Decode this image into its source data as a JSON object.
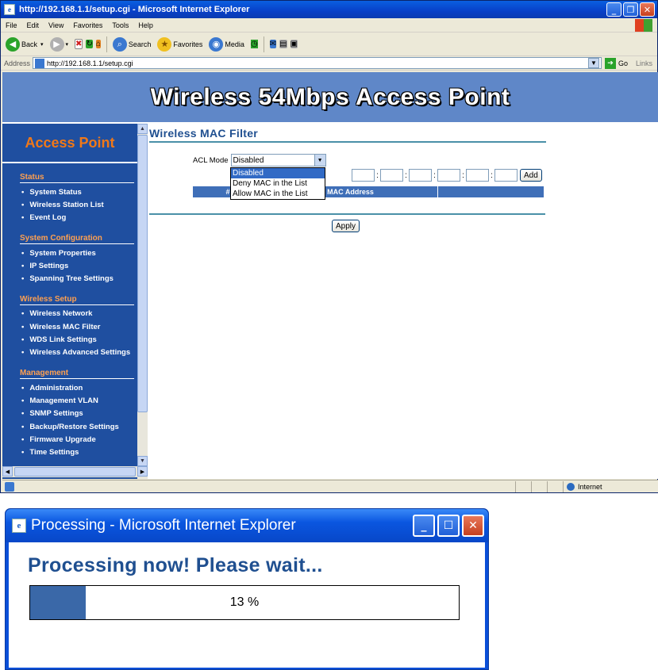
{
  "browser": {
    "title": "http://192.168.1.1/setup.cgi - Microsoft Internet Explorer",
    "menu": [
      "File",
      "Edit",
      "View",
      "Favorites",
      "Tools",
      "Help"
    ],
    "toolbar": {
      "back": "Back",
      "search": "Search",
      "favorites": "Favorites",
      "media": "Media"
    },
    "address_label": "Address",
    "address_url": "http://192.168.1.1/setup.cgi",
    "go_label": "Go",
    "links_label": "Links",
    "status_zone": "Internet"
  },
  "page": {
    "banner_title": "Wireless 54Mbps Access Point",
    "sidebar": {
      "heading": "Access Point",
      "sections": [
        {
          "title": "Status",
          "items": [
            "System Status",
            "Wireless Station List",
            "Event Log"
          ]
        },
        {
          "title": "System Configuration",
          "items": [
            "System Properties",
            "IP Settings",
            "Spanning Tree Settings"
          ]
        },
        {
          "title": "Wireless Setup",
          "items": [
            "Wireless Network",
            "Wireless MAC Filter",
            "WDS Link Settings",
            "Wireless Advanced Settings"
          ]
        },
        {
          "title": "Management",
          "items": [
            "Administration",
            "Management VLAN",
            "SNMP Settings",
            "Backup/Restore Settings",
            "Firmware Upgrade",
            "Time Settings"
          ]
        }
      ]
    },
    "main": {
      "title": "Wireless MAC Filter",
      "acl_label": "ACL Mode",
      "acl_value": "Disabled",
      "acl_options": [
        "Disabled",
        "Deny MAC in the List",
        "Allow MAC in the List"
      ],
      "add_label": "Add",
      "table_headers": [
        "#",
        "MAC Address",
        ""
      ],
      "apply_label": "Apply"
    }
  },
  "processing": {
    "title": "Processing - Microsoft Internet Explorer",
    "heading": "Processing now! Please wait...",
    "progress_percent": 13,
    "progress_text": "13 %"
  },
  "colors": {
    "banner": "#5f87c8",
    "sidebar": "#1f4fa0",
    "sidebar_heading": "#f07818",
    "section_title": "#ffa050",
    "content_title": "#1f4f90",
    "progress_fill": "#3a68a8"
  }
}
